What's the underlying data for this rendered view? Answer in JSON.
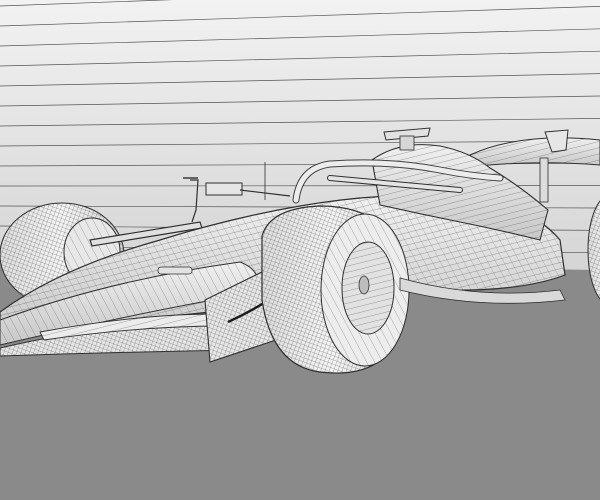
{
  "scene": {
    "subject": "wireframe-formula-one-car",
    "colors": {
      "backdrop_top": "#f2f2f2",
      "backdrop_bottom": "#d0d0d0",
      "floor": "#8a8a8a",
      "wire": "#2f2f2f",
      "surface": "#e9e9e9",
      "surface_shade": "#c9c9c9"
    }
  }
}
